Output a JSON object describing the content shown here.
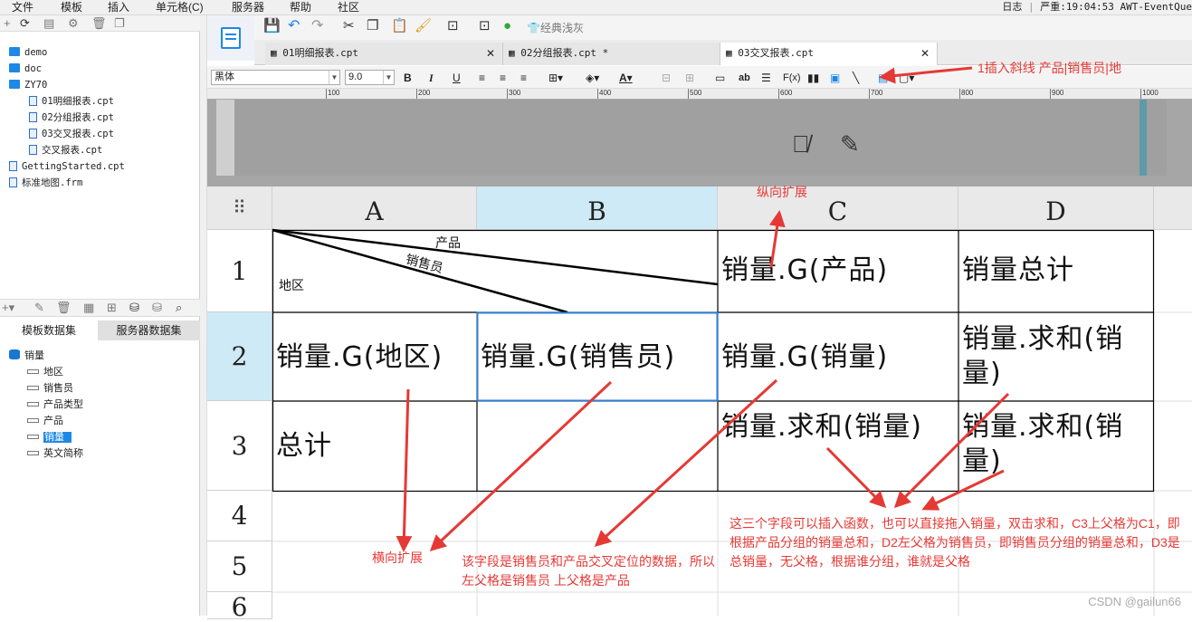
{
  "menu": [
    "文件",
    "模板",
    "插入",
    "单元格(C)",
    "服务器",
    "帮助",
    "社区"
  ],
  "status": {
    "log": "日志",
    "level": "严重:19:04:53 AWT-EventQue"
  },
  "tree": [
    {
      "label": "demo",
      "type": "folder"
    },
    {
      "label": "doc",
      "type": "folder"
    },
    {
      "label": "ZY70",
      "type": "folder"
    },
    {
      "label": "01明细报表.cpt",
      "type": "file"
    },
    {
      "label": "02分组报表.cpt",
      "type": "file"
    },
    {
      "label": "03交叉报表.cpt",
      "type": "file"
    },
    {
      "label": "交叉报表.cpt",
      "type": "file"
    },
    {
      "label": "GettingStarted.cpt",
      "type": "file"
    },
    {
      "label": "标准地图.frm",
      "type": "file"
    }
  ],
  "dataset_tabs": [
    "模板数据集",
    "服务器数据集"
  ],
  "dataset": {
    "name": "销量",
    "fields": [
      "地区",
      "销售员",
      "产品类型",
      "产品",
      "销量",
      "英文简称"
    ],
    "selected_index": 4
  },
  "toolbar": {
    "format_painter_label": "经典浅灰"
  },
  "doc_tabs": [
    {
      "label": "01明细报表.cpt",
      "active": false
    },
    {
      "label": "02分组报表.cpt *",
      "active": false
    },
    {
      "label": "03交叉报表.cpt",
      "active": true
    }
  ],
  "font": {
    "name": "黑体",
    "size": "9.0"
  },
  "ruler_ticks": [
    "100",
    "200",
    "300",
    "400",
    "500",
    "600",
    "700",
    "800",
    "900",
    "1000"
  ],
  "columns": [
    "A",
    "B",
    "C",
    "D"
  ],
  "rows": [
    "1",
    "2",
    "3",
    "4",
    "5",
    "6"
  ],
  "cells": {
    "A1_top": "产品",
    "A1_mid": "销售员",
    "A1_bottom": "地区",
    "C1": "销量.G(产品)",
    "D1": "销量总计",
    "A2": "销量.G(地区)",
    "B2": "销量.G(销售员)",
    "C2": "销量.G(销量)",
    "D2": "销量.求和(销量)",
    "A3": "总计",
    "C3": "销量.求和(销量)",
    "D3": "销量.求和(销量)"
  },
  "annotations": {
    "diagonal": "1插入斜线 产品|销售员|地",
    "vertical": "纵向扩展",
    "horizontal": "横向扩展",
    "cross": "该字段是销售员和产品交叉定位的数据，所以左父格是销售员 上父格是产品",
    "functions": "这三个字段可以插入函数，也可以直接拖入销量，双击求和，C3上父格为C1，即根据产品分组的销量总和，D2左父格为销售员，即销售员分组的销量总和，D3是总销量，无父格，根据谁分组，谁就是父格"
  },
  "watermark": "CSDN @gailun66",
  "colors": {
    "annotation": "#e53935",
    "selection": "#cdeaf6",
    "selection_border": "#2f7fd8",
    "accent": "#1e88e5"
  }
}
